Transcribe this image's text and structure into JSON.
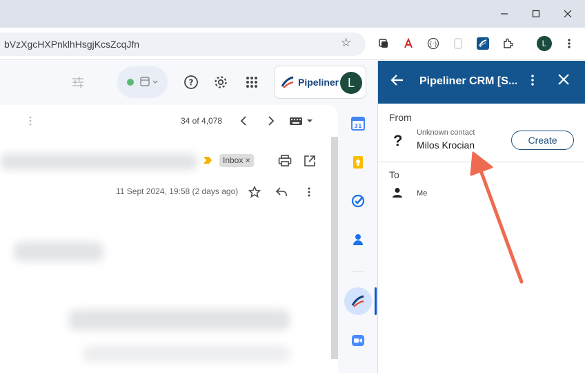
{
  "browser": {
    "url": "bVzXgcHXPnklhHsgjKcsZcqJfn",
    "profile_initial": "L"
  },
  "gmail": {
    "pipeliner_label": "Pipeliner",
    "avatar_initial": "L",
    "message_count": "34 of 4,078",
    "inbox_label": "Inbox",
    "inbox_remove": "×",
    "date": "11 Sept 2024, 19:58 (2 days ago)"
  },
  "panel": {
    "title": "Pipeliner CRM [S...",
    "from_label": "From",
    "unknown_label": "Unknown contact",
    "contact_name": "Milos Krocian",
    "create_label": "Create",
    "to_label": "To",
    "recipient": "Me"
  },
  "colors": {
    "panel_header": "#14558f",
    "annotation_arrow": "#ee6a50",
    "avatar": "#1b4b3e"
  }
}
